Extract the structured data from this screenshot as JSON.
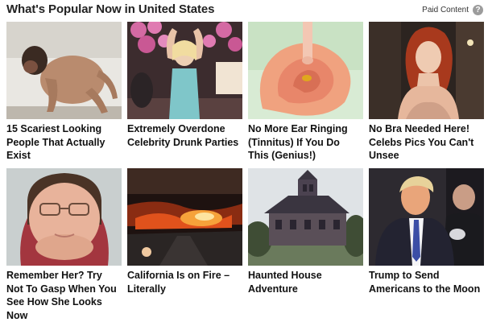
{
  "header": {
    "title": "What's Popular Now in United States",
    "paid_label": "Paid Content",
    "help_glyph": "?"
  },
  "cards": [
    {
      "headline": "15 Scariest Looking People That Actually Exist"
    },
    {
      "headline": "Extremely Overdone Celebrity Drunk Parties"
    },
    {
      "headline": "No More Ear Ringing (Tinnitus) If You Do This (Genius!)"
    },
    {
      "headline": "No Bra Needed Here! Celebs Pics You Can't Unsee"
    },
    {
      "headline": "Remember Her? Try Not To Gasp When You See How She Looks Now"
    },
    {
      "headline": "California Is on Fire – Literally"
    },
    {
      "headline": "Haunted House Adventure"
    },
    {
      "headline": "Trump to Send Americans to the Moon"
    }
  ]
}
